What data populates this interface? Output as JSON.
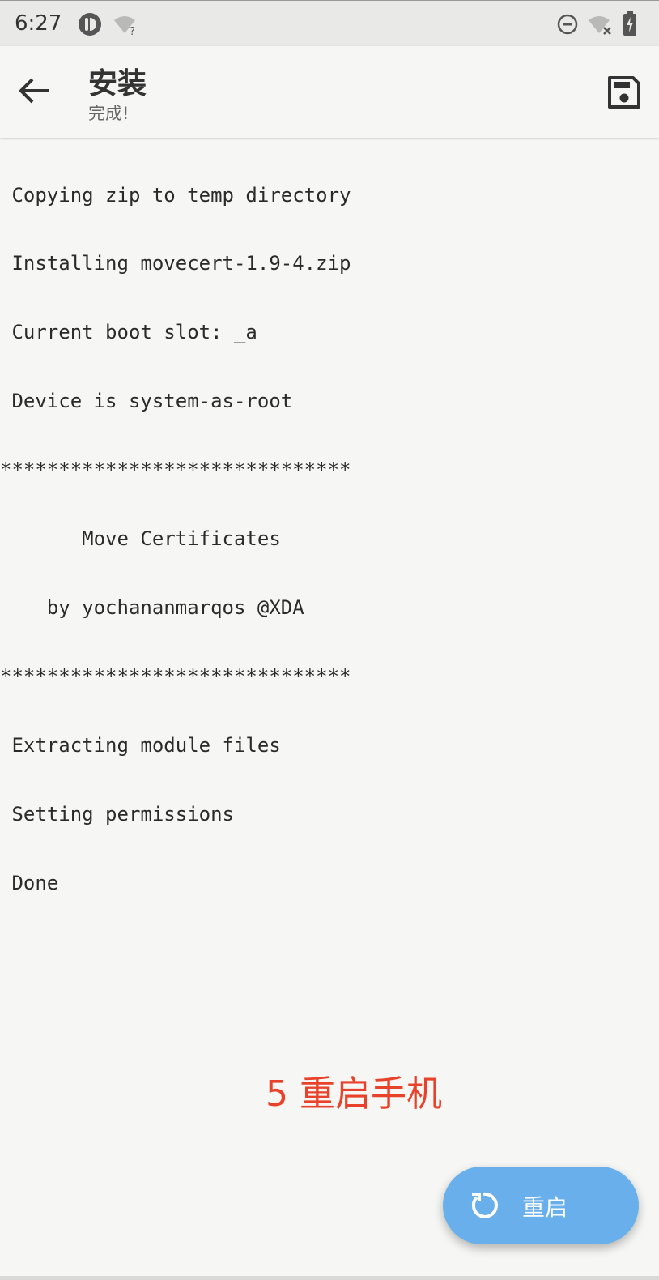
{
  "status_bar": {
    "time": "6:27",
    "left_icons": [
      "app-notification-icon",
      "wifi-unknown-icon"
    ],
    "wifi_question_mark": "?",
    "right_icons": [
      "do-not-disturb-icon",
      "wifi-off-icon",
      "battery-charging-icon"
    ]
  },
  "app_bar": {
    "back_icon": "arrow-left-icon",
    "title": "安装",
    "subtitle": "完成!",
    "save_icon": "save-icon"
  },
  "log": {
    "lines": [
      " Copying zip to temp directory",
      " Installing movecert-1.9-4.zip",
      " Current boot slot: _a",
      " Device is system-as-root",
      "******************************",
      "       Move Certificates",
      "    by yochananmarqos @XDA",
      "******************************",
      " Extracting module files",
      " Setting permissions",
      " Done"
    ]
  },
  "annotation": {
    "text": "5 重启手机"
  },
  "fab": {
    "icon": "restart-icon",
    "label": "重启"
  },
  "colors": {
    "background": "#f6f7f5",
    "status_bar": "#e9eae8",
    "fab": "#68afeb",
    "annotation": "#e8432a"
  }
}
